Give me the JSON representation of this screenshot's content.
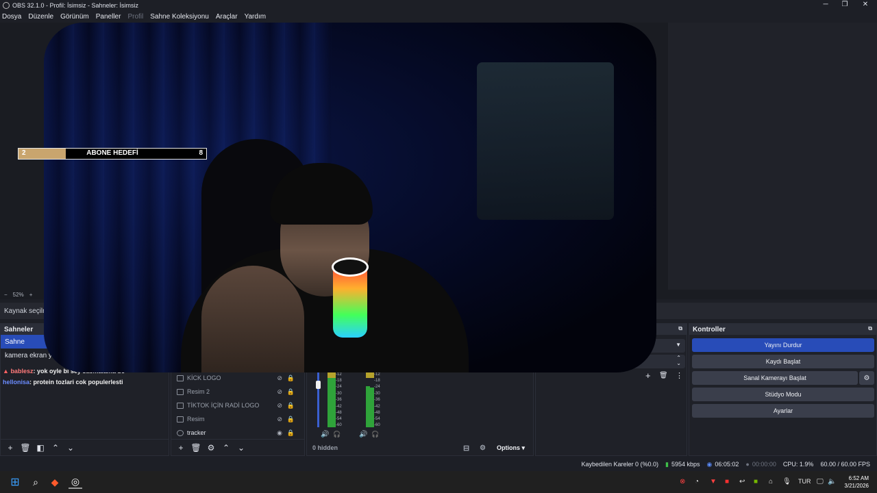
{
  "window": {
    "title": "OBS 32.1.0 - Profil: İsimsiz - Sahneler: İsimsiz",
    "min": "─",
    "max": "❐",
    "close": "✕"
  },
  "menu": [
    "Dosya",
    "Düzenle",
    "Görünüm",
    "Paneller",
    "Profil",
    "Sahne Koleksiyonu",
    "Araçlar",
    "Yardım"
  ],
  "preview": {
    "zoom": "52%",
    "zoom_out": "−",
    "zoom_in": "+"
  },
  "source_bar": {
    "text": "Kaynak seçilme"
  },
  "goal_overlay": {
    "current": "2",
    "label": "ABONE HEDEFİ",
    "target": "8",
    "progress": 0.25
  },
  "scenes": {
    "title": "Sahneler",
    "items": [
      {
        "label": "Sahne",
        "selected": true
      },
      {
        "label": "kamera ekran yakalama",
        "selected": false
      }
    ]
  },
  "chat": [
    {
      "user": "bablesz",
      "message": ": yok oyle bi sey sacmalama be",
      "badge": "▲"
    },
    {
      "user": "hellonisa",
      "message": ": protein tozlari cok populerlesti",
      "badge": ""
    }
  ],
  "sources": {
    "items": [
      {
        "label": "KİCK LOGO",
        "eye": "hidden",
        "lock": true
      },
      {
        "label": "Resim 2",
        "eye": "hidden",
        "lock": true
      },
      {
        "label": "TİKTOK İÇİN RADİ LOGO",
        "eye": "hidden",
        "lock": true
      },
      {
        "label": "Resim",
        "eye": "hidden",
        "lock": true
      },
      {
        "label": "tracker",
        "eye": "visible",
        "lock": true
      }
    ]
  },
  "mixer": {
    "db_scale": [
      "-12",
      "-18",
      "-24",
      "-30",
      "-36",
      "-42",
      "-48",
      "-54",
      "-60"
    ],
    "hidden_label": "0 hidden",
    "options_label": "Options"
  },
  "controls": {
    "title": "Kontroller",
    "buttons": {
      "stream": "Yayını Durdur",
      "record": "Kaydı Başlat",
      "vcam": "Sanal Kamerayı Başlat",
      "studio": "Stüdyo Modu",
      "settings": "Ayarlar"
    }
  },
  "status": {
    "dropped": "Kaybedilen Kareler 0 (%0.0)",
    "bitrate": "5954 kbps",
    "stream_time": "06:05:02",
    "rec_time": "00:00:00",
    "cpu": "CPU: 1.9%",
    "fps": "60.00 / 60.00 FPS"
  },
  "taskbar": {
    "lang": "TUR",
    "time": "6:52 AM",
    "date": "3/21/2026"
  },
  "colors": {
    "accent": "#284cb8",
    "bg": "#1d1f26",
    "dock": "#1f2128"
  }
}
